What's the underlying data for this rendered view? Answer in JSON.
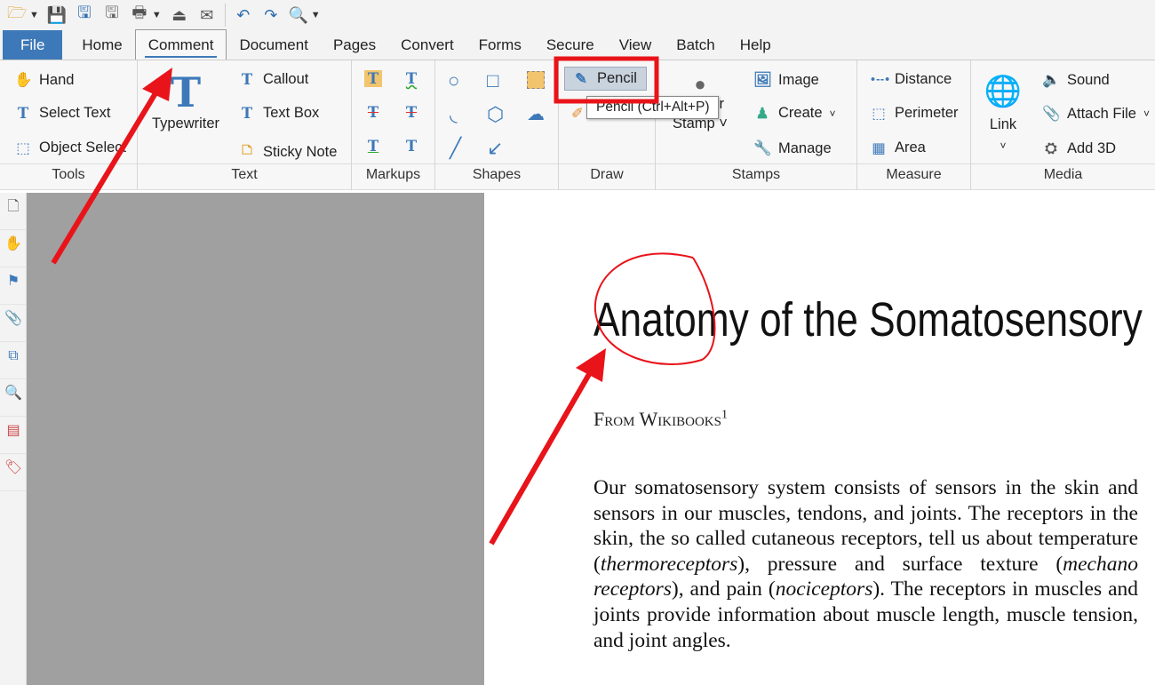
{
  "quick_access": {
    "icons": [
      "open-icon",
      "save-icon",
      "save-as-icon",
      "save-all-icon",
      "print-icon",
      "scan-icon",
      "email-icon",
      "undo-icon",
      "redo-icon",
      "find-icon"
    ]
  },
  "tabs": [
    "File",
    "Home",
    "Comment",
    "Document",
    "Pages",
    "Convert",
    "Forms",
    "Secure",
    "View",
    "Batch",
    "Help"
  ],
  "active_tab": "Comment",
  "ribbon": {
    "tools": {
      "label": "Tools",
      "hand": "Hand",
      "select_text": "Select Text",
      "object_select": "Object Select"
    },
    "text": {
      "label": "Text",
      "typewriter": "Typewriter",
      "callout": "Callout",
      "text_box": "Text Box",
      "sticky_note": "Sticky Note"
    },
    "markups": {
      "label": "Markups"
    },
    "shapes": {
      "label": "Shapes"
    },
    "draw": {
      "label": "Draw",
      "pencil": "Pencil"
    },
    "stamps": {
      "label": "Stamps",
      "rubber_stamp_1": "Rubber",
      "rubber_stamp_2": "Stamp",
      "image": "Image",
      "create": "Create",
      "manage": "Manage"
    },
    "measure": {
      "label": "Measure",
      "distance": "Distance",
      "perimeter": "Perimeter",
      "area": "Area"
    },
    "media": {
      "label": "Media",
      "link": "Link",
      "sound": "Sound",
      "attach_file": "Attach File",
      "add_3d": "Add 3D"
    }
  },
  "tooltip": "Pencil  (Ctrl+Alt+P)",
  "document": {
    "title": "Anatomy of the Somatosensory System",
    "subtitle": "From Wikibooks",
    "footnote_mark": "1",
    "body": [
      {
        "t": "Our somatosensory system consists of sensors in the skin and sensors in our muscles, tendons, and joints. The receptors in the skin, the so called cutaneous receptors, tell us about temperature (",
        "i": false
      },
      {
        "t": "thermoreceptors",
        "i": true
      },
      {
        "t": "), pressure and surface texture (",
        "i": false
      },
      {
        "t": "mechano receptors",
        "i": true
      },
      {
        "t": "), and pain (",
        "i": false
      },
      {
        "t": "nociceptors",
        "i": true
      },
      {
        "t": "). The receptors in muscles and joints provide information about muscle length, muscle tension, and joint angles.",
        "i": false
      }
    ]
  },
  "colors": {
    "accent": "#3d79b8",
    "annotation": "#e8141a",
    "canvas": "#a0a0a0"
  }
}
